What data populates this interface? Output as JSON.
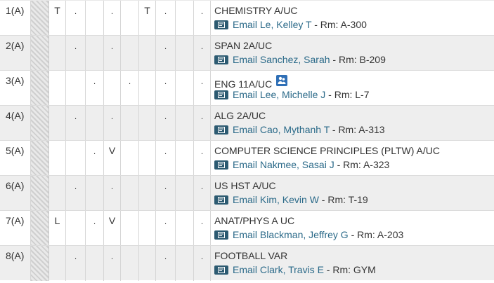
{
  "rows": [
    {
      "period": "1(A)",
      "days": [
        "T",
        ".",
        "",
        ".",
        "",
        "T",
        ".",
        "",
        "."
      ],
      "course": "CHEMISTRY A/UC",
      "email_label": "Email Le, Kelley T",
      "room": " - Rm: A-300",
      "has_group_icon": false
    },
    {
      "period": "2(A)",
      "days": [
        "",
        ".",
        "",
        ".",
        "",
        "",
        ".",
        "",
        "."
      ],
      "course": "SPAN 2A/UC",
      "email_label": "Email Sanchez, Sarah",
      "room": " - Rm: B-209",
      "has_group_icon": false
    },
    {
      "period": "3(A)",
      "days": [
        "",
        "",
        ".",
        "",
        ".",
        "",
        ".",
        "",
        "."
      ],
      "course": "ENG 11A/UC",
      "email_label": "Email Lee, Michelle J",
      "room": " - Rm: L-7",
      "has_group_icon": true
    },
    {
      "period": "4(A)",
      "days": [
        "",
        ".",
        "",
        ".",
        "",
        "",
        ".",
        "",
        "."
      ],
      "course": "ALG 2A/UC",
      "email_label": "Email Cao, Mythanh T",
      "room": " - Rm: A-313",
      "has_group_icon": false
    },
    {
      "period": "5(A)",
      "days": [
        "",
        "",
        ".",
        "V",
        "",
        "",
        ".",
        "",
        "."
      ],
      "course": "COMPUTER SCIENCE PRINCIPLES (PLTW) A/UC",
      "email_label": "Email Nakmee, Sasai J",
      "room": " - Rm: A-323",
      "has_group_icon": false
    },
    {
      "period": "6(A)",
      "days": [
        "",
        ".",
        "",
        ".",
        "",
        "",
        ".",
        "",
        "."
      ],
      "course": "US HST A/UC",
      "email_label": "Email Kim, Kevin W",
      "room": " - Rm: T-19",
      "has_group_icon": false
    },
    {
      "period": "7(A)",
      "days": [
        "L",
        "",
        ".",
        "V",
        "",
        "",
        ".",
        "",
        "."
      ],
      "course": "ANAT/PHYS A UC",
      "email_label": "Email Blackman, Jeffrey G",
      "room": " - Rm: A-203",
      "has_group_icon": false
    },
    {
      "period": "8(A)",
      "days": [
        "",
        ".",
        "",
        ".",
        "",
        "",
        ".",
        "",
        "."
      ],
      "course": "FOOTBALL VAR",
      "email_label": "Email Clark, Travis E",
      "room": " - Rm: GYM",
      "has_group_icon": false
    }
  ]
}
